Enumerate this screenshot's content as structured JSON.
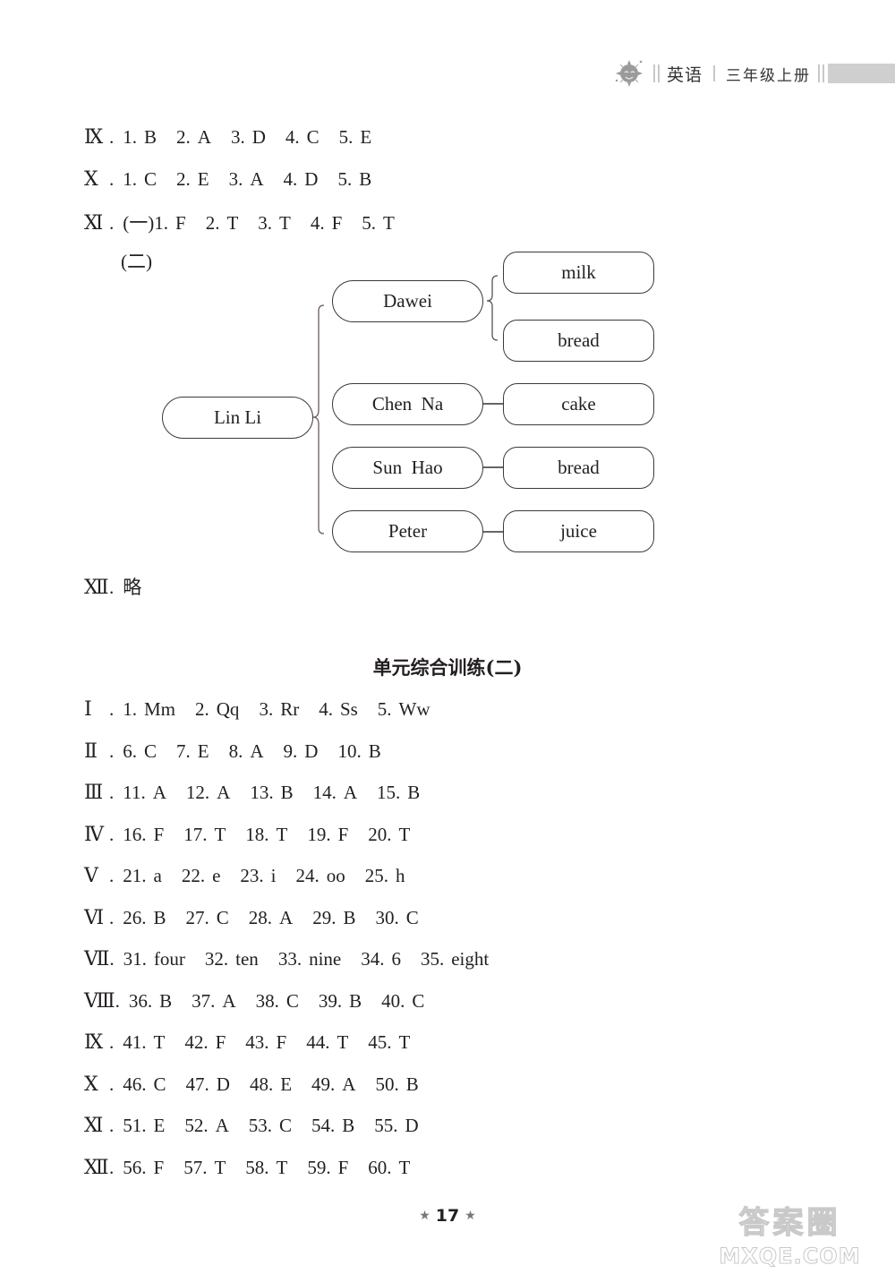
{
  "header": {
    "icon": "sun-mascot-icon",
    "subject": "英语",
    "grade": "三年级上册"
  },
  "part1": {
    "rows": [
      {
        "roman": "Ⅸ",
        "items": [
          [
            "1.",
            "B"
          ],
          [
            "2.",
            "A"
          ],
          [
            "3.",
            "D"
          ],
          [
            "4.",
            "C"
          ],
          [
            "5.",
            "E"
          ]
        ]
      },
      {
        "roman": "Ⅹ",
        "items": [
          [
            "1.",
            "C"
          ],
          [
            "2.",
            "E"
          ],
          [
            "3.",
            "A"
          ],
          [
            "4.",
            "D"
          ],
          [
            "5.",
            "B"
          ]
        ]
      },
      {
        "roman": "Ⅺ",
        "sub_label": "(一)",
        "items": [
          [
            "1.",
            "F"
          ],
          [
            "2.",
            "T"
          ],
          [
            "3.",
            "T"
          ],
          [
            "4.",
            "F"
          ],
          [
            "5.",
            "T"
          ]
        ]
      }
    ],
    "sub2_label": "(二)",
    "diagram": {
      "root": "Lin Li",
      "branches": [
        {
          "name": "Dawei",
          "foods": [
            "milk",
            "bread"
          ]
        },
        {
          "name": "Chen  Na",
          "foods": [
            "cake"
          ]
        },
        {
          "name": "Sun  Hao",
          "foods": [
            "bread"
          ]
        },
        {
          "name": "Peter",
          "foods": [
            "juice"
          ]
        }
      ]
    },
    "xii": {
      "roman": "Ⅻ",
      "text": "略"
    }
  },
  "section_title": "单元综合训练(二)",
  "part2": {
    "rows": [
      {
        "roman": "Ⅰ",
        "items": [
          [
            "1.",
            "Mm"
          ],
          [
            "2.",
            "Qq"
          ],
          [
            "3.",
            "Rr"
          ],
          [
            "4.",
            "Ss"
          ],
          [
            "5.",
            "Ww"
          ]
        ]
      },
      {
        "roman": "Ⅱ",
        "items": [
          [
            "6.",
            "C"
          ],
          [
            "7.",
            "E"
          ],
          [
            "8.",
            "A"
          ],
          [
            "9.",
            "D"
          ],
          [
            "10.",
            "B"
          ]
        ]
      },
      {
        "roman": "Ⅲ",
        "items": [
          [
            "11.",
            "A"
          ],
          [
            "12.",
            "A"
          ],
          [
            "13.",
            "B"
          ],
          [
            "14.",
            "A"
          ],
          [
            "15.",
            "B"
          ]
        ]
      },
      {
        "roman": "Ⅳ",
        "items": [
          [
            "16.",
            "F"
          ],
          [
            "17.",
            "T"
          ],
          [
            "18.",
            "T"
          ],
          [
            "19.",
            "F"
          ],
          [
            "20.",
            "T"
          ]
        ]
      },
      {
        "roman": "Ⅴ",
        "items": [
          [
            "21.",
            "a"
          ],
          [
            "22.",
            "e"
          ],
          [
            "23.",
            "i"
          ],
          [
            "24.",
            "oo"
          ],
          [
            "25.",
            "h"
          ]
        ]
      },
      {
        "roman": "Ⅵ",
        "items": [
          [
            "26.",
            "B"
          ],
          [
            "27.",
            "C"
          ],
          [
            "28.",
            "A"
          ],
          [
            "29.",
            "B"
          ],
          [
            "30.",
            "C"
          ]
        ]
      },
      {
        "roman": "Ⅶ",
        "items": [
          [
            "31.",
            "four"
          ],
          [
            "32.",
            "ten"
          ],
          [
            "33.",
            "nine"
          ],
          [
            "34.",
            "6"
          ],
          [
            "35.",
            "eight"
          ]
        ]
      },
      {
        "roman": "Ⅷ",
        "items": [
          [
            "36.",
            "B"
          ],
          [
            "37.",
            "A"
          ],
          [
            "38.",
            "C"
          ],
          [
            "39.",
            "B"
          ],
          [
            "40.",
            "C"
          ]
        ]
      },
      {
        "roman": "Ⅸ",
        "items": [
          [
            "41.",
            "T"
          ],
          [
            "42.",
            "F"
          ],
          [
            "43.",
            "F"
          ],
          [
            "44.",
            "T"
          ],
          [
            "45.",
            "T"
          ]
        ]
      },
      {
        "roman": "Ⅹ",
        "items": [
          [
            "46.",
            "C"
          ],
          [
            "47.",
            "D"
          ],
          [
            "48.",
            "E"
          ],
          [
            "49.",
            "A"
          ],
          [
            "50.",
            "B"
          ]
        ]
      },
      {
        "roman": "Ⅺ",
        "items": [
          [
            "51.",
            "E"
          ],
          [
            "52.",
            "A"
          ],
          [
            "53.",
            "C"
          ],
          [
            "54.",
            "B"
          ],
          [
            "55.",
            "D"
          ]
        ]
      },
      {
        "roman": "Ⅻ",
        "items": [
          [
            "56.",
            "F"
          ],
          [
            "57.",
            "T"
          ],
          [
            "58.",
            "T"
          ],
          [
            "59.",
            "F"
          ],
          [
            "60.",
            "T"
          ]
        ]
      }
    ]
  },
  "footer": {
    "page_number": "17",
    "star": "★"
  },
  "watermark": {
    "cn": "答案圈",
    "en": "MXQE.COM"
  }
}
